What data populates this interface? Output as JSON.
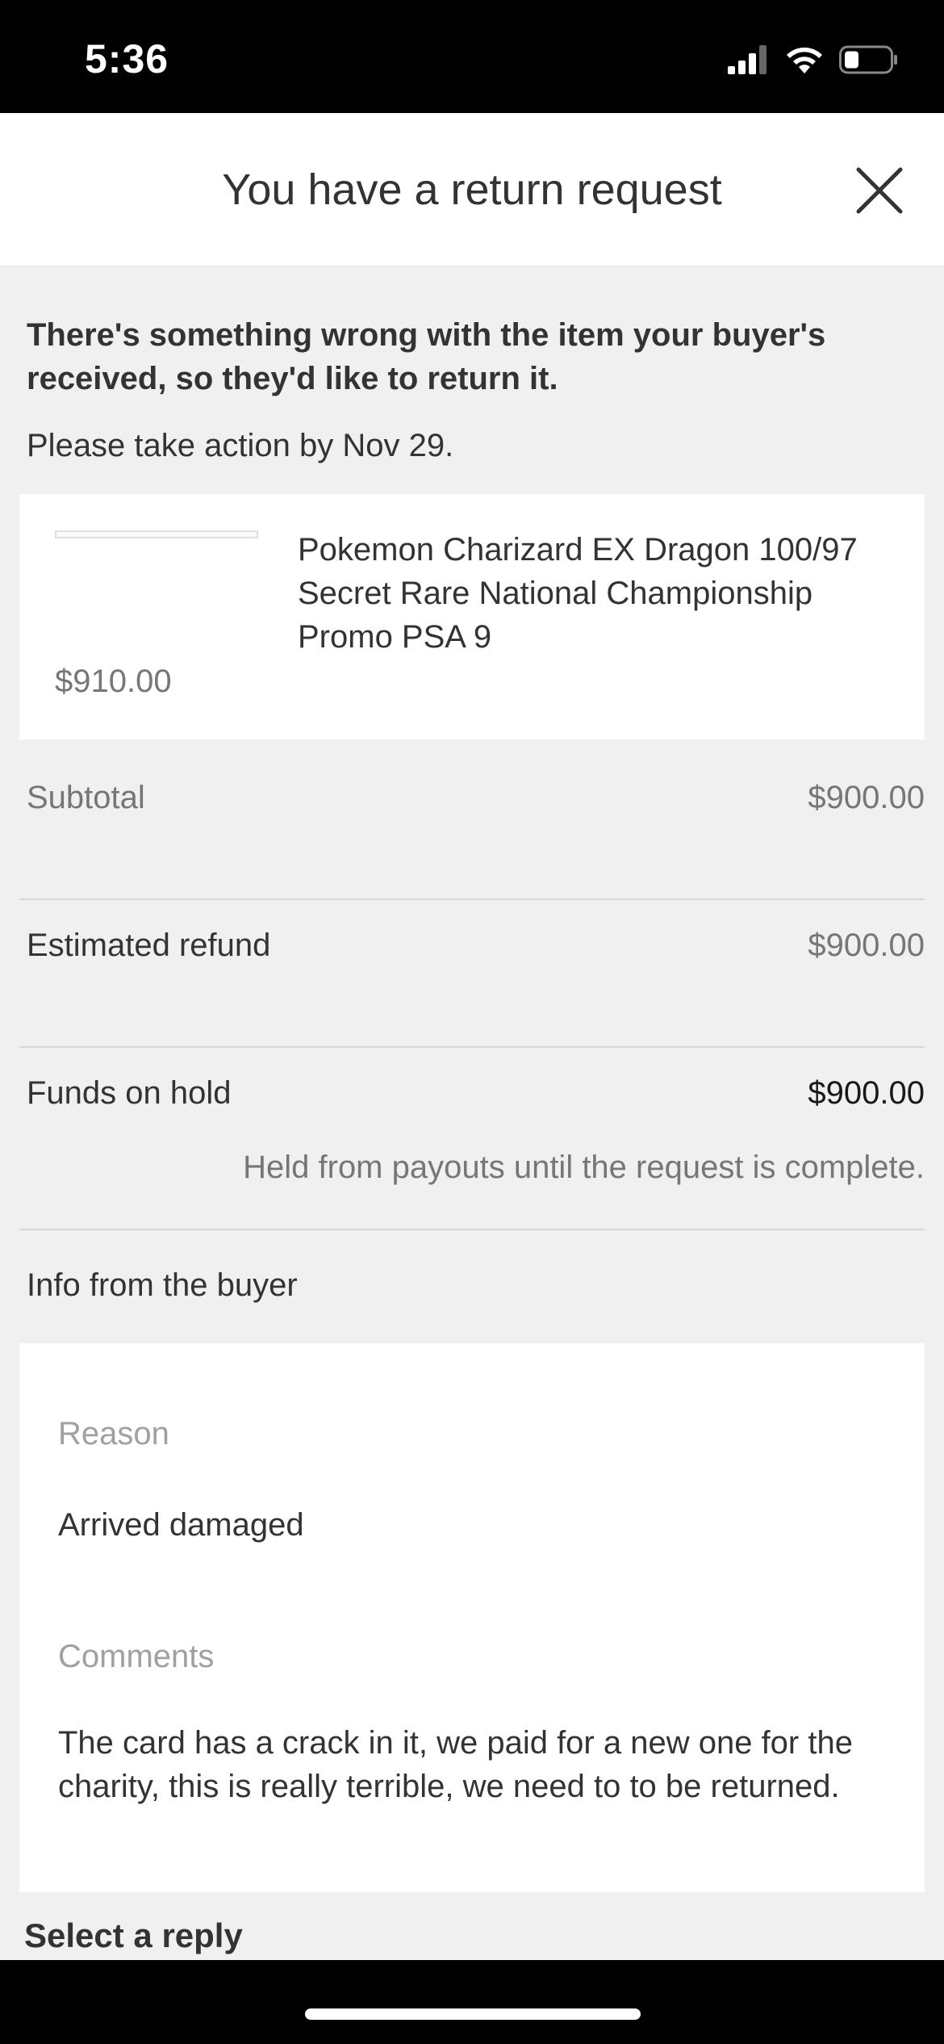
{
  "status_bar": {
    "time": "5:36"
  },
  "header": {
    "title": "You have a return request"
  },
  "intro": {
    "message": "There's something wrong with the item your buyer's received, so they'd like to return it.",
    "deadline": "Please take action by Nov 29."
  },
  "item": {
    "title": "Pokemon Charizard EX Dragon 100/97 Secret Rare National Championship Promo PSA 9",
    "price": "$910.00"
  },
  "summary": {
    "subtotal_label": "Subtotal",
    "subtotal_value": "$900.00",
    "refund_label": "Estimated refund",
    "refund_value": "$900.00",
    "hold_label": "Funds on hold",
    "hold_value": "$900.00",
    "hold_note": "Held from payouts until the request is complete."
  },
  "buyer_info": {
    "heading": "Info from the buyer",
    "reason_label": "Reason",
    "reason_value": "Arrived damaged",
    "comments_label": "Comments",
    "comments_value": "The card has a crack in it, we paid for a new one for the charity, this is really terrible, we need to to be returned."
  },
  "reply": {
    "heading": "Select a reply"
  }
}
